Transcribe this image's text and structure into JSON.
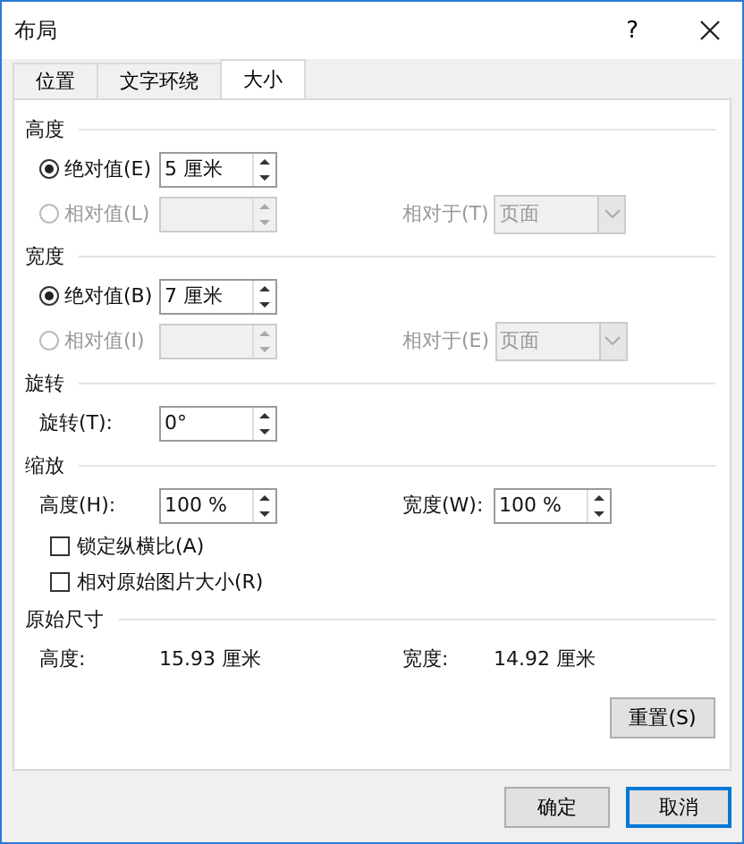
{
  "window": {
    "title": "布局",
    "help": "?"
  },
  "tabs": [
    {
      "label": "位置",
      "selected": false
    },
    {
      "label": "文字环绕",
      "selected": false
    },
    {
      "label": "大小",
      "selected": true
    }
  ],
  "sections": [
    {
      "title": "高度",
      "rows": [
        {
          "kind": "radio",
          "label": "绝对值(E)",
          "selected": true,
          "disabled": false,
          "value": "5 厘米"
        },
        {
          "kind": "radio",
          "label": "相对值(L)",
          "selected": false,
          "disabled": true,
          "relative_label": "相对于(T)",
          "relative_value": "页面"
        }
      ]
    },
    {
      "title": "宽度",
      "rows": [
        {
          "kind": "radio",
          "label": "绝对值(B)",
          "selected": true,
          "disabled": false,
          "value": "7 厘米"
        },
        {
          "kind": "radio",
          "label": "相对值(I)",
          "selected": false,
          "disabled": true,
          "relative_label": "相对于(E)",
          "relative_value": "页面"
        }
      ]
    },
    {
      "title": "旋转",
      "rows": [
        {
          "kind": "spin",
          "label": "旋转(T):",
          "value": "0°"
        }
      ]
    },
    {
      "title": "缩放",
      "rows": [
        {
          "kind": "pair",
          "label": "高度(H):",
          "value": "100 %",
          "label_2": "宽度(W):",
          "value_2": "100 %"
        },
        {
          "kind": "checkbox",
          "label": "锁定纵横比(A)",
          "checked": false
        },
        {
          "kind": "checkbox",
          "label": "相对原始图片大小(R)",
          "checked": false
        }
      ]
    },
    {
      "title": "原始尺寸",
      "rows": [
        {
          "kind": "info",
          "label": "高度:",
          "value": "15.93 厘米",
          "label_2": "宽度:",
          "value_2": "14.92 厘米"
        }
      ]
    }
  ],
  "reset_button": "重置(S)",
  "buttons": [
    {
      "label": "确定",
      "default": false
    },
    {
      "label": "取消",
      "default": true
    }
  ]
}
